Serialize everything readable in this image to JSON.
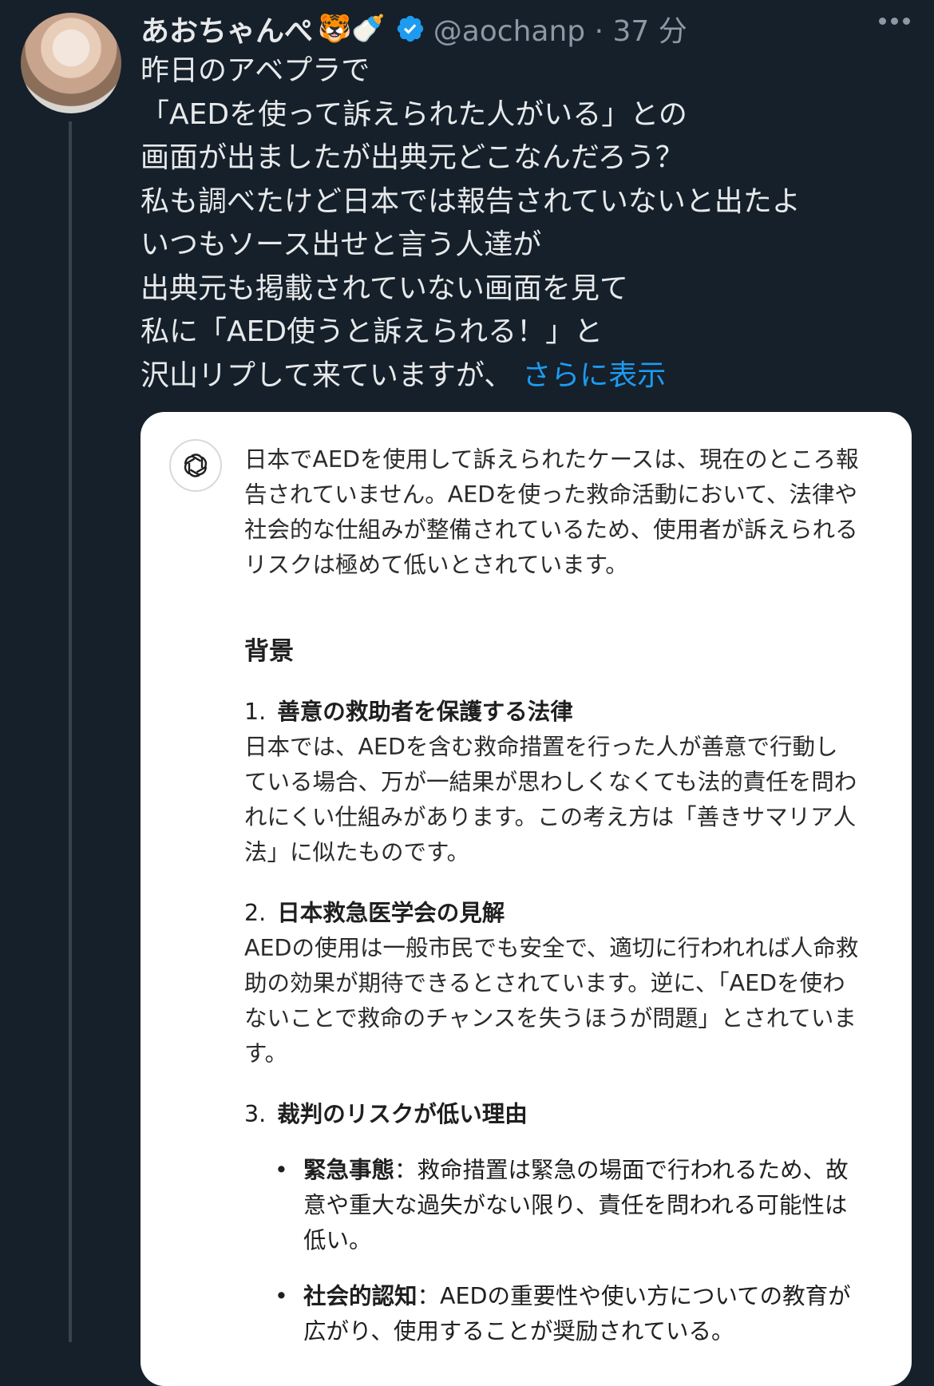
{
  "author": {
    "display_name": "あおちゃんぺ",
    "emojis": "🐯🍼",
    "handle": "@aochanp",
    "separator": "·",
    "time_ago": "37 分"
  },
  "tweet": {
    "lines": [
      "昨日のアベプラで",
      "「AEDを使って訴えられた人がいる」との",
      "画面が出ましたが出典元どこなんだろう？",
      "私も調べたけど日本では報告されていないと出たよ",
      "いつもソース出せと言う人達が",
      "出典元も掲載されていない画面を見て",
      "私に「AED使うと訴えられる！」と",
      "沢山リプして来ていますが、"
    ],
    "show_more": "さらに表示"
  },
  "card": {
    "intro": "日本でAEDを使用して訴えられたケースは、現在のところ報告されていません。AEDを使った救命活動において、法律や社会的な仕組みが整備されているため、使用者が訴えられるリスクは極めて低いとされています。",
    "heading": "背景",
    "items": [
      {
        "num": "1.",
        "title": "善意の救助者を保護する法律",
        "body": "日本では、AEDを含む救命措置を行った人が善意で行動している場合、万が一結果が思わしくなくても法的責任を問われにくい仕組みがあります。この考え方は「善きサマリア人法」に似たものです。"
      },
      {
        "num": "2.",
        "title": "日本救急医学会の見解",
        "body": "AEDの使用は一般市民でも安全で、適切に行われれば人命救助の効果が期待できるとされています。逆に、「AEDを使わないことで救命のチャンスを失うほうが問題」とされています。"
      },
      {
        "num": "3.",
        "title": "裁判のリスクが低い理由",
        "body": ""
      }
    ],
    "bullets": [
      {
        "term": "緊急事態",
        "sep": "：",
        "text": "救命措置は緊急の場面で行われるため、故意や重大な過失がない限り、責任を問われる可能性は低い。"
      },
      {
        "term": "社会的認知",
        "sep": "：",
        "text": "AEDの重要性や使い方についての教育が広がり、使用することが奨励されている。"
      }
    ]
  },
  "colors": {
    "background": "#15202b",
    "link": "#1d9bf0",
    "verified": "#1d9bf0",
    "muted": "#8b98a5"
  }
}
